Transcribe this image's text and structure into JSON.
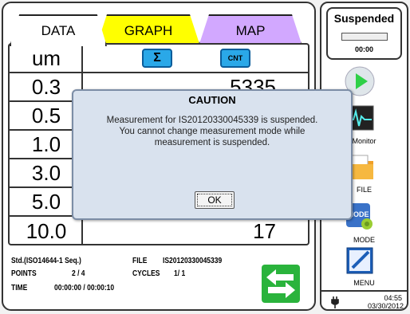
{
  "tabs": [
    {
      "label": "DATA"
    },
    {
      "label": "GRAPH"
    },
    {
      "label": "MAP"
    }
  ],
  "table": {
    "header_unit": "um",
    "sum_button": "Σ",
    "cnt_button": "CNT",
    "rows": [
      {
        "size": "0.3",
        "count": "5335"
      },
      {
        "size": "0.5",
        "count": ""
      },
      {
        "size": "1.0",
        "count": ""
      },
      {
        "size": "3.0",
        "count": ""
      },
      {
        "size": "5.0",
        "count": ""
      },
      {
        "size": "10.0",
        "count": "17"
      }
    ]
  },
  "status": {
    "std": "Std.(ISO14644-1 Seq.)",
    "file_label": "FILE",
    "file_value": "IS20120330045339",
    "points_label": "POINTS",
    "points_value": "2 / 4",
    "cycles_label": "CYCLES",
    "cycles_value": "1/ 1",
    "time_label": "TIME",
    "time_value": "00:00:00 / 00:00:10"
  },
  "sidebar": {
    "state": "Suspended",
    "timer": "00:00",
    "monitor_label": "Monitor",
    "file_label": "FILE",
    "mode_label": "MODE",
    "mode_icon_text": "MODE",
    "menu_label": "MENU",
    "time": "04:55",
    "date": "03/30/2012"
  },
  "dialog": {
    "title": "CAUTION",
    "line1": "Measurement for IS20120330045339 is suspended.",
    "line2": "You cannot change measurement mode while",
    "line3": "measurement is suspended.",
    "ok": "OK"
  },
  "colors": {
    "tab_graph": "#ffff00",
    "tab_map": "#d2a8ff",
    "button_blue": "#2aa8e8",
    "arrow_green": "#2ab33c",
    "play_green": "#2fd047"
  },
  "icons": [
    "sigma-icon",
    "play-icon",
    "monitor-icon",
    "folder-icon",
    "mode-icon",
    "menu-pen-icon",
    "arrows-icon",
    "plug-icon"
  ]
}
